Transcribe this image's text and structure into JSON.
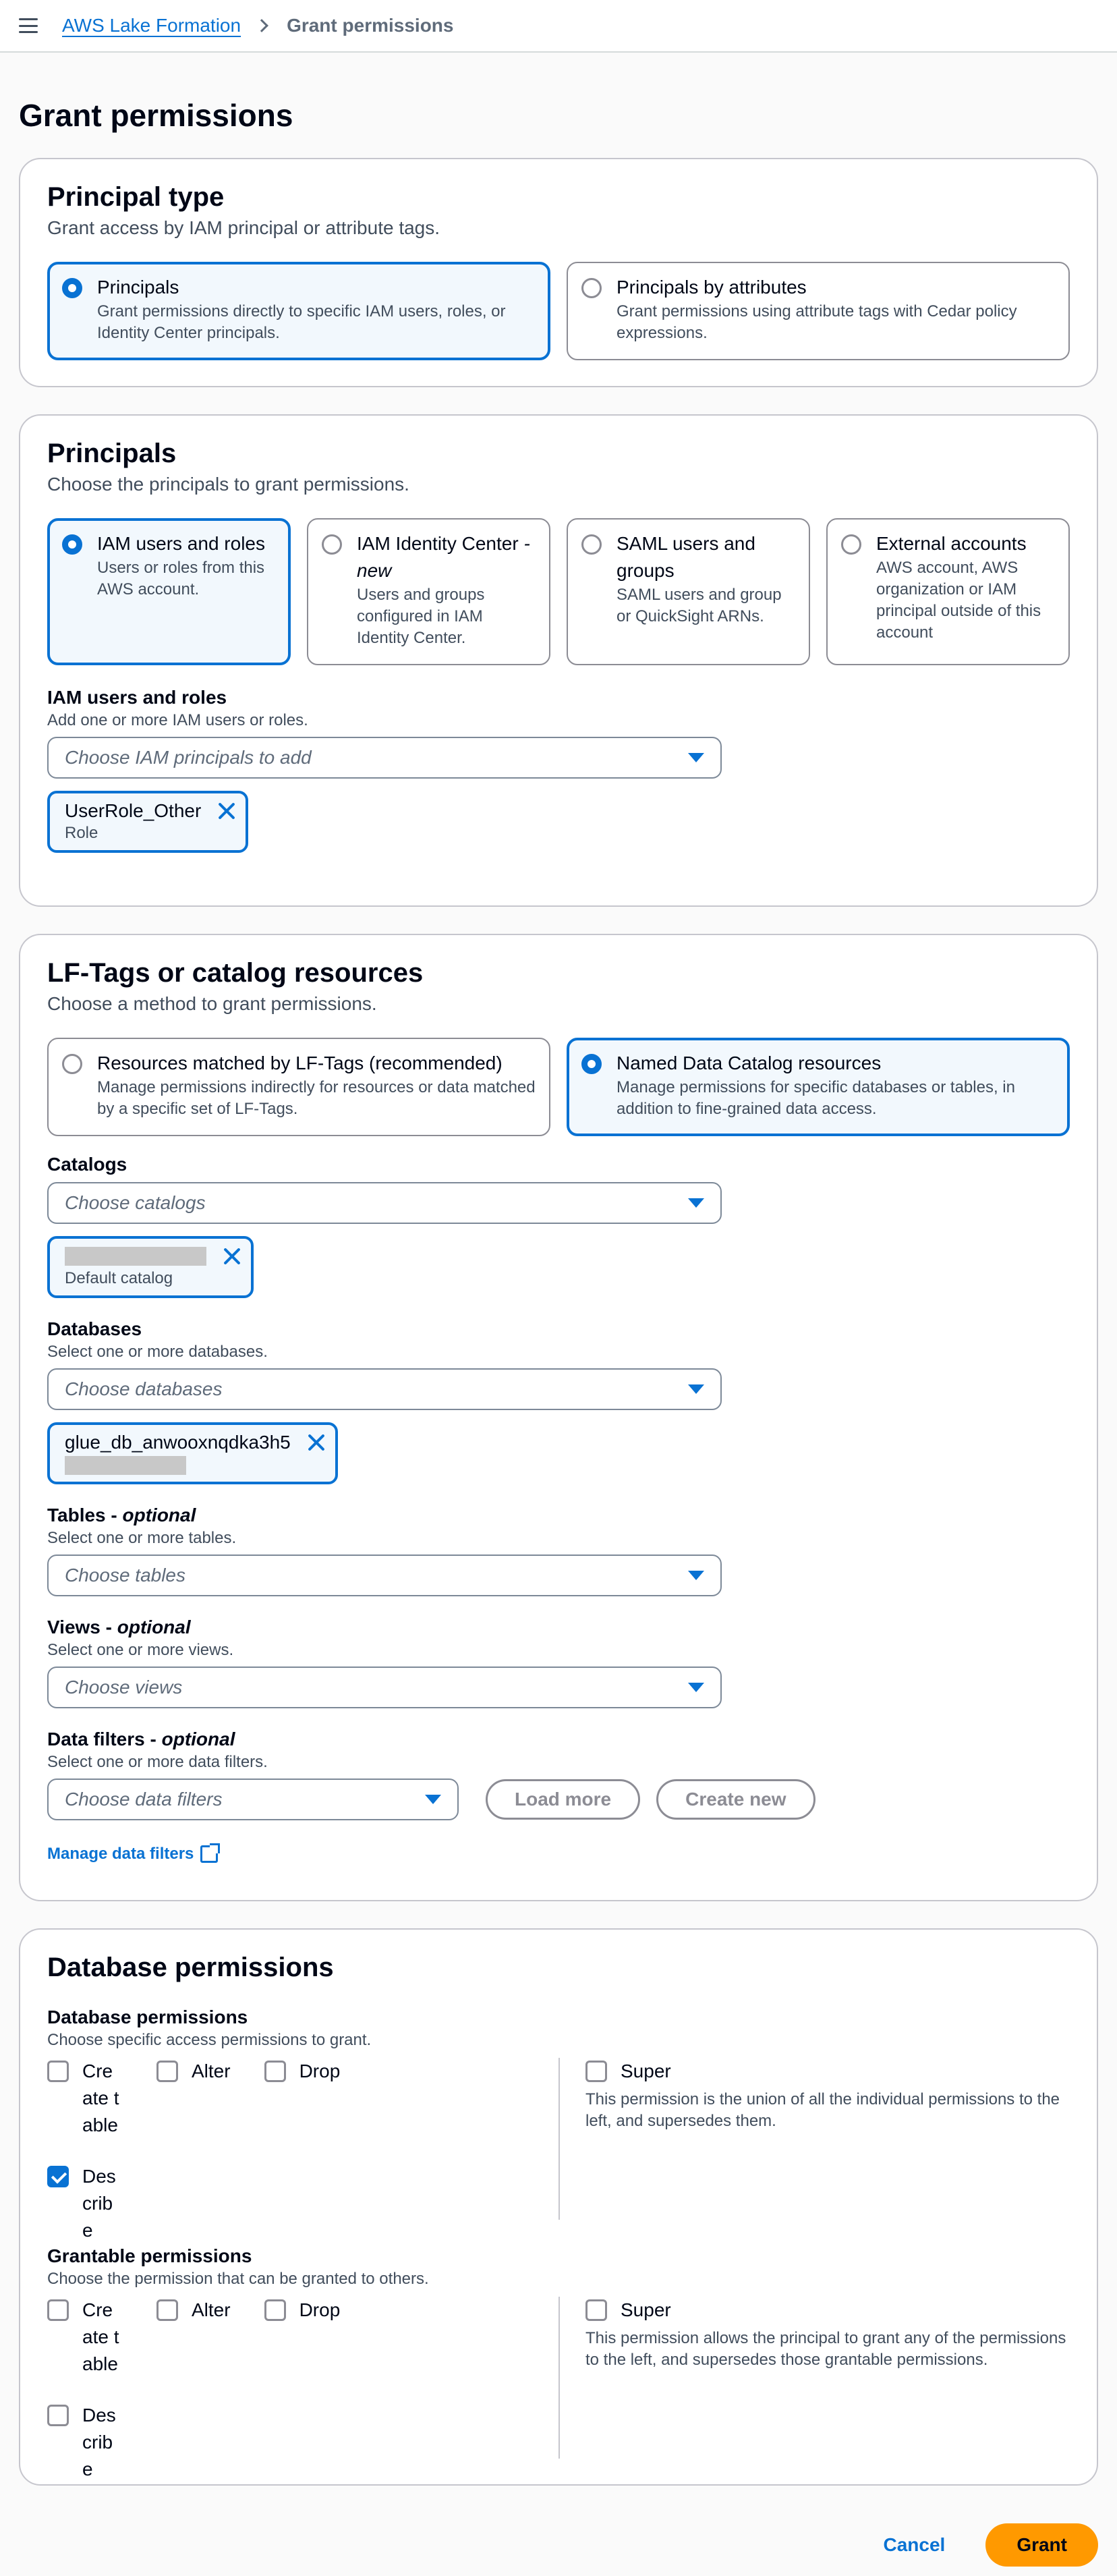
{
  "breadcrumb": {
    "root": "AWS Lake Formation",
    "current": "Grant permissions"
  },
  "page_title": "Grant permissions",
  "principal_type": {
    "title": "Principal type",
    "description": "Grant access by IAM principal or attribute tags.",
    "options": [
      {
        "label": "Principals",
        "description": "Grant permissions directly to specific IAM users, roles, or Identity Center principals.",
        "selected": true
      },
      {
        "label": "Principals by attributes",
        "description": "Grant permissions using attribute tags with Cedar policy expressions.",
        "selected": false
      }
    ]
  },
  "principals": {
    "title": "Principals",
    "description": "Choose the principals to grant permissions.",
    "options": [
      {
        "label": "IAM users and roles",
        "description": "Users or roles from this AWS account.",
        "selected": true
      },
      {
        "label": "IAM Identity Center",
        "label_suffix": "- new",
        "description": "Users and groups configured in IAM Identity Center.",
        "selected": false
      },
      {
        "label": "SAML users and groups",
        "description": "SAML users and group or QuickSight ARNs.",
        "selected": false
      },
      {
        "label": "External accounts",
        "description": "AWS account, AWS organization or IAM principal outside of this account",
        "selected": false
      }
    ],
    "iam_field": {
      "label": "IAM users and roles",
      "description": "Add one or more IAM users or roles.",
      "placeholder": "Choose IAM principals to add",
      "token": {
        "name": "UserRole_Other",
        "type": "Role"
      }
    }
  },
  "resources": {
    "title": "LF-Tags or catalog resources",
    "description": "Choose a method to grant permissions.",
    "options": [
      {
        "label": "Resources matched by LF-Tags (recommended)",
        "description": "Manage permissions indirectly for resources or data matched by a specific set of LF-Tags.",
        "selected": false
      },
      {
        "label": "Named Data Catalog resources",
        "description": "Manage permissions for specific databases or tables, in addition to fine-grained data access.",
        "selected": true
      }
    ],
    "catalogs": {
      "label": "Catalogs",
      "placeholder": "Choose catalogs",
      "token_sub": "Default catalog"
    },
    "databases": {
      "label": "Databases",
      "description": "Select one or more databases.",
      "placeholder": "Choose databases",
      "token_name": "glue_db_anwooxnqdka3h5"
    },
    "tables": {
      "label": "Tables",
      "optional": "optional",
      "description": "Select one or more tables.",
      "placeholder": "Choose tables"
    },
    "views": {
      "label": "Views",
      "optional": "optional",
      "description": "Select one or more views.",
      "placeholder": "Choose views"
    },
    "data_filters": {
      "label": "Data filters",
      "optional": "optional",
      "description": "Select one or more data filters.",
      "placeholder": "Choose data filters",
      "load_more": "Load more",
      "create_new": "Create new",
      "manage_link": "Manage data filters"
    }
  },
  "db_permissions": {
    "title": "Database permissions",
    "database": {
      "label": "Database permissions",
      "description": "Choose specific access permissions to grant.",
      "items": [
        {
          "label": "Create table",
          "checked": false
        },
        {
          "label": "Alter",
          "checked": false
        },
        {
          "label": "Drop",
          "checked": false
        },
        {
          "label": "Describe",
          "checked": true
        }
      ],
      "super_label": "Super",
      "super_note": "This permission is the union of all the individual permissions to the left, and supersedes them."
    },
    "grantable": {
      "label": "Grantable permissions",
      "description": "Choose the permission that can be granted to others.",
      "items": [
        {
          "label": "Create table",
          "checked": false
        },
        {
          "label": "Alter",
          "checked": false
        },
        {
          "label": "Drop",
          "checked": false
        },
        {
          "label": "Describe",
          "checked": false
        }
      ],
      "super_label": "Super",
      "super_note": "This permission allows the principal to grant any of the permissions to the left, and supersedes those grantable permissions."
    }
  },
  "footer": {
    "cancel": "Cancel",
    "grant": "Grant"
  },
  "colors": {
    "accent": "#0972d3",
    "primary_button": "#ff9900"
  }
}
